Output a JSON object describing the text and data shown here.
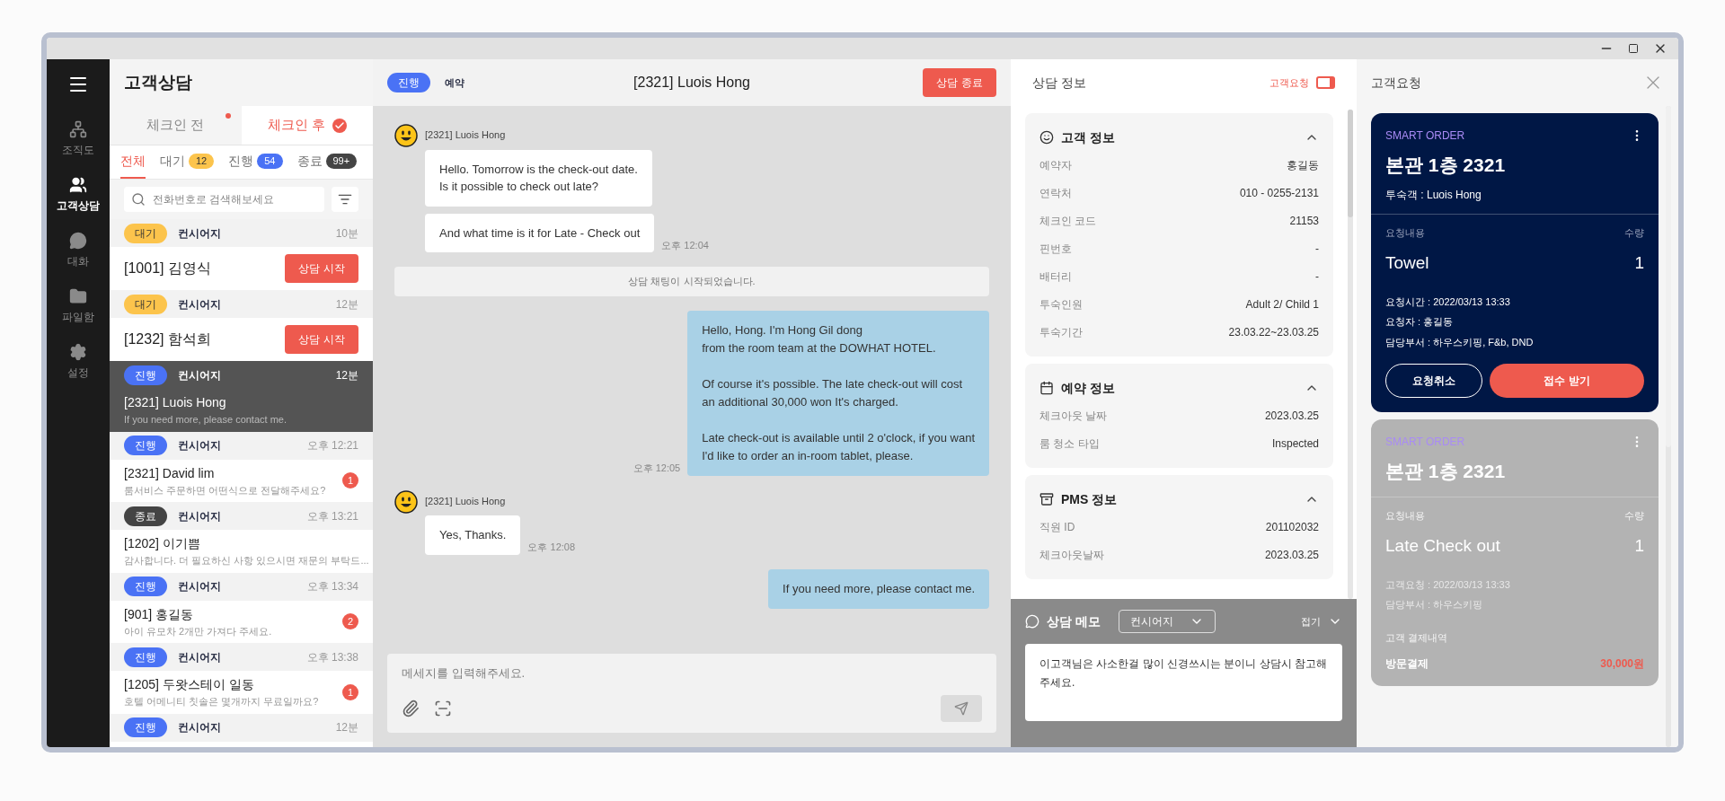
{
  "nav": {
    "items": [
      {
        "label": "조직도",
        "selected": false
      },
      {
        "label": "고객상담",
        "selected": true
      },
      {
        "label": "대화",
        "selected": false
      },
      {
        "label": "파일함",
        "selected": false
      },
      {
        "label": "설정",
        "selected": false
      }
    ]
  },
  "list": {
    "title": "고객상담",
    "tabs": [
      {
        "label": "체크인 전",
        "selected": false,
        "dot": true
      },
      {
        "label": "체크인 후",
        "selected": true,
        "dot": false
      }
    ],
    "filters": [
      {
        "label": "전체",
        "selected": true
      },
      {
        "label": "대기",
        "count": "12",
        "color": "#fcc44c",
        "selected": false
      },
      {
        "label": "진행",
        "count": "54",
        "color": "#4a72f5",
        "selected": false
      },
      {
        "label": "종료",
        "count": "99+",
        "color": "#444444",
        "selected": false
      }
    ],
    "search": {
      "placeholder": "전화번호로 검색해보세요"
    },
    "items": [
      {
        "kind": "waiting",
        "status": "대기",
        "dept": "컨시어지",
        "time": "10분",
        "name": "[1001]  김영식",
        "button": "상담 시작",
        "selected": false
      },
      {
        "kind": "waiting",
        "status": "대기",
        "dept": "컨시어지",
        "time": "12분",
        "name": "[1232]  함석희",
        "button": "상담 시작",
        "selected": false
      },
      {
        "kind": "active",
        "status": "진행",
        "dept": "컨시어지",
        "time": "12분",
        "name": "[2321] Luois Hong",
        "preview": "If you need more, please contact me.",
        "selected": true
      },
      {
        "kind": "active",
        "status": "진행",
        "dept": "컨시어지",
        "time": "오후 12:21",
        "name": "[2321] David lim",
        "preview": "룸서비스 주문하면 어떤식으로 전달해주세요?",
        "unread": "1",
        "selected": false
      },
      {
        "kind": "ended",
        "status": "종료",
        "dept": "컨시어지",
        "time": "오후 13:21",
        "name": "[1202] 이기쁨",
        "preview": "감사합니다. 더 필요하신 사항 있으시면 재문의 부탁드...",
        "selected": false
      },
      {
        "kind": "active",
        "status": "진행",
        "dept": "컨시어지",
        "time": "오후 13:34",
        "name": "[901] 홍길동",
        "preview": "아이 유모차 2개만 가져다 주세요.",
        "unread": "2",
        "selected": false
      },
      {
        "kind": "active",
        "status": "진행",
        "dept": "컨시어지",
        "time": "오후 13:38",
        "name": "[1205] 두왓스테이 일동",
        "preview": "호텔 어메니티 칫솔은 몇개까지 무료일까요?",
        "unread": "1",
        "selected": false
      },
      {
        "kind": "active",
        "status": "진행",
        "dept": "컨시어지",
        "time": "12분",
        "selected": false
      }
    ]
  },
  "chat": {
    "status": "진행",
    "category": "예약",
    "title": "[2321] Luois Hong",
    "end_button": "상담 종료",
    "messages": [
      {
        "kind": "incoming",
        "sender": "[2321] Luois Hong",
        "bubbles": [
          "Hello. Tomorrow is the check-out date.\nIs it possible to check out late?",
          "And what time is it for Late - Check out"
        ],
        "time": "오후 12:04"
      },
      {
        "kind": "system",
        "text": "상담 채팅이 시작되었습니다."
      },
      {
        "kind": "outgoing",
        "bubbles": [
          "Hello, Hong. I'm Hong Gil dong\nfrom the room team at the DOWHAT HOTEL.\n\nOf course it's possible. The late check-out will cost\nan additional 30,000 won It's charged.\n\nLate check-out is available until 2 o'clock, if you want\nI'd like to order an in-room tablet, please."
        ],
        "time": "오후 12:05"
      },
      {
        "kind": "incoming",
        "sender": "[2321] Luois Hong",
        "bubbles": [
          "Yes, Thanks."
        ],
        "time": "오후 12:08"
      },
      {
        "kind": "outgoing",
        "bubbles": [
          "If you need more, please contact me."
        ]
      }
    ],
    "input": {
      "placeholder": "메세지를 입력해주세요."
    }
  },
  "info": {
    "title": "상담 정보",
    "toggle_label": "고객요청",
    "sections": [
      {
        "title": "고객 정보",
        "expanded": true,
        "rows": [
          [
            "예약자",
            "홍길동"
          ],
          [
            "연락처",
            "010 - 0255-2131"
          ],
          [
            "체크인 코드",
            "21153"
          ],
          [
            "핀번호",
            "-"
          ],
          [
            "배터리",
            "-"
          ],
          [
            "투숙인원",
            "Adult 2/ Child 1"
          ],
          [
            "투숙기간",
            "23.03.22~23.03.25"
          ]
        ]
      },
      {
        "title": "예약 정보",
        "expanded": true,
        "rows": [
          [
            "체크아웃 날짜",
            "2023.03.25"
          ],
          [
            "룸 청소 타입",
            "Inspected"
          ]
        ]
      },
      {
        "title": "PMS 정보",
        "expanded": true,
        "rows": [
          [
            "직원 ID",
            "201102032"
          ],
          [
            "체크아웃날짜",
            "2023.03.25"
          ]
        ]
      }
    ],
    "memo": {
      "title": "상담 메모",
      "dept": "컨시어지",
      "collapse": "접기",
      "text": "이고객님은 사소한걸 많이 신경쓰시는 분이니 상담시 참고해주세요."
    }
  },
  "requests": {
    "title": "고객요청",
    "cards": [
      {
        "disabled": false,
        "tag": "SMART ORDER",
        "room": "본관 1층 2321",
        "guest": "투숙객 : Luois Hong",
        "label_item": "요청내용",
        "label_qty": "수량",
        "item": "Towel",
        "qty": "1",
        "details": [
          "요청시간 : 2022/03/13 13:33",
          "요청자 : 홍길동",
          "담당부서 : 하우스키핑, F&b, DND"
        ],
        "buttons": [
          "요청취소",
          "접수 받기"
        ]
      },
      {
        "disabled": true,
        "tag": "SMART ORDER",
        "room": "본관 1층 2321",
        "label_item": "요청내용",
        "label_qty": "수량",
        "item": "Late Check out",
        "qty": "1",
        "details": [
          "고객요청 : 2022/03/13 13:33",
          "담당부서 : 하우스키핑"
        ],
        "payment_label": "고객 결제내역",
        "payments": [
          [
            "방문결제",
            "30,000원"
          ]
        ]
      }
    ]
  }
}
